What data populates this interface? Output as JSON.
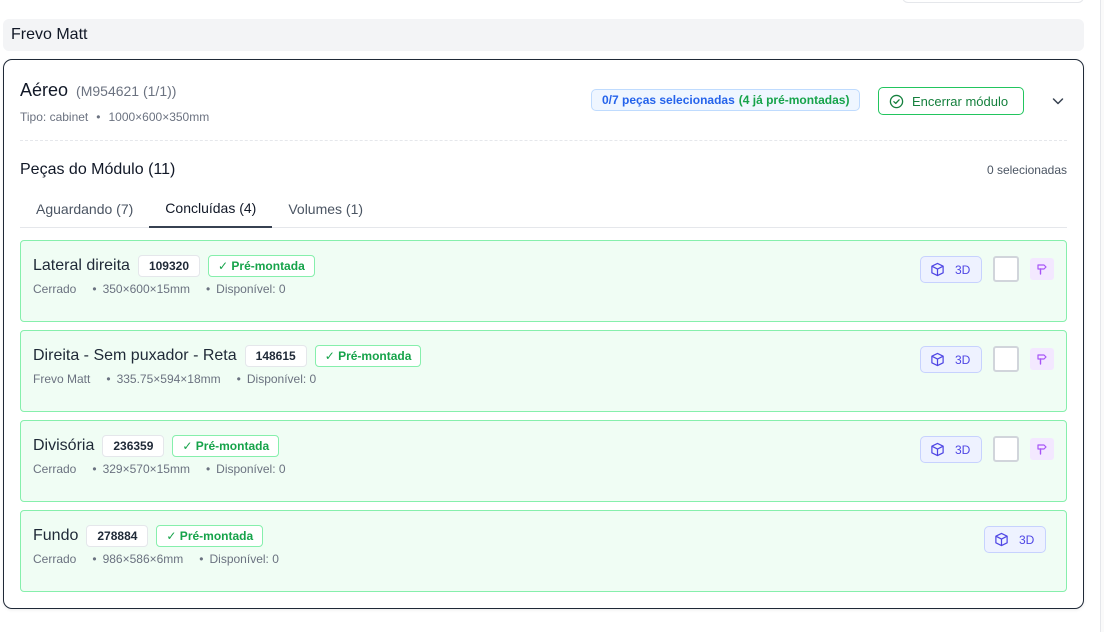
{
  "group": {
    "title": "Frevo Matt"
  },
  "module": {
    "name": "Aéreo",
    "code": "(M954621 (1/1))",
    "type_label": "Tipo: cabinet",
    "dimensions": "1000×600×350mm",
    "selection_badge": {
      "main": "0/7 peças selecionadas",
      "premounted": "(4 já pré-montadas)"
    },
    "close_button_label": "Encerrar módulo"
  },
  "pieces_section": {
    "title": "Peças do Módulo (11)",
    "selected_count": "0 selecionadas",
    "tabs": [
      {
        "label": "Aguardando (7)",
        "active": false
      },
      {
        "label": "Concluídas (4)",
        "active": true
      },
      {
        "label": "Volumes (1)",
        "active": false
      }
    ]
  },
  "pieces": [
    {
      "name": "Lateral direita",
      "code": "109320",
      "status": "✓ Pré-montada",
      "material": "Cerrado",
      "dimensions": "350×600×15mm",
      "available": "Disponível: 0",
      "button_3d": "3D",
      "has_checkbox": true
    },
    {
      "name": "Direita - Sem puxador - Reta",
      "code": "148615",
      "status": "✓ Pré-montada",
      "material": "Frevo Matt",
      "dimensions": "335.75×594×18mm",
      "available": "Disponível: 0",
      "button_3d": "3D",
      "has_checkbox": true
    },
    {
      "name": "Divisória",
      "code": "236359",
      "status": "✓ Pré-montada",
      "material": "Cerrado",
      "dimensions": "329×570×15mm",
      "available": "Disponível: 0",
      "button_3d": "3D",
      "has_checkbox": true
    },
    {
      "name": "Fundo",
      "code": "278884",
      "status": "✓ Pré-montada",
      "material": "Cerrado",
      "dimensions": "986×586×6mm",
      "available": "Disponível: 0",
      "button_3d": "3D",
      "has_checkbox": false
    }
  ],
  "colors": {
    "piece_border": "#86efac",
    "piece_bg": "#f0fdf4",
    "accent_green": "#16a34a",
    "accent_blue": "#2563eb",
    "accent_indigo": "#4f46e5",
    "tool_purple": "#a855f7"
  },
  "icons": {
    "close_module": "check-circle-icon",
    "collapse": "chevron-down-icon",
    "view_3d": "cube-icon",
    "tool": "hammer-icon"
  }
}
